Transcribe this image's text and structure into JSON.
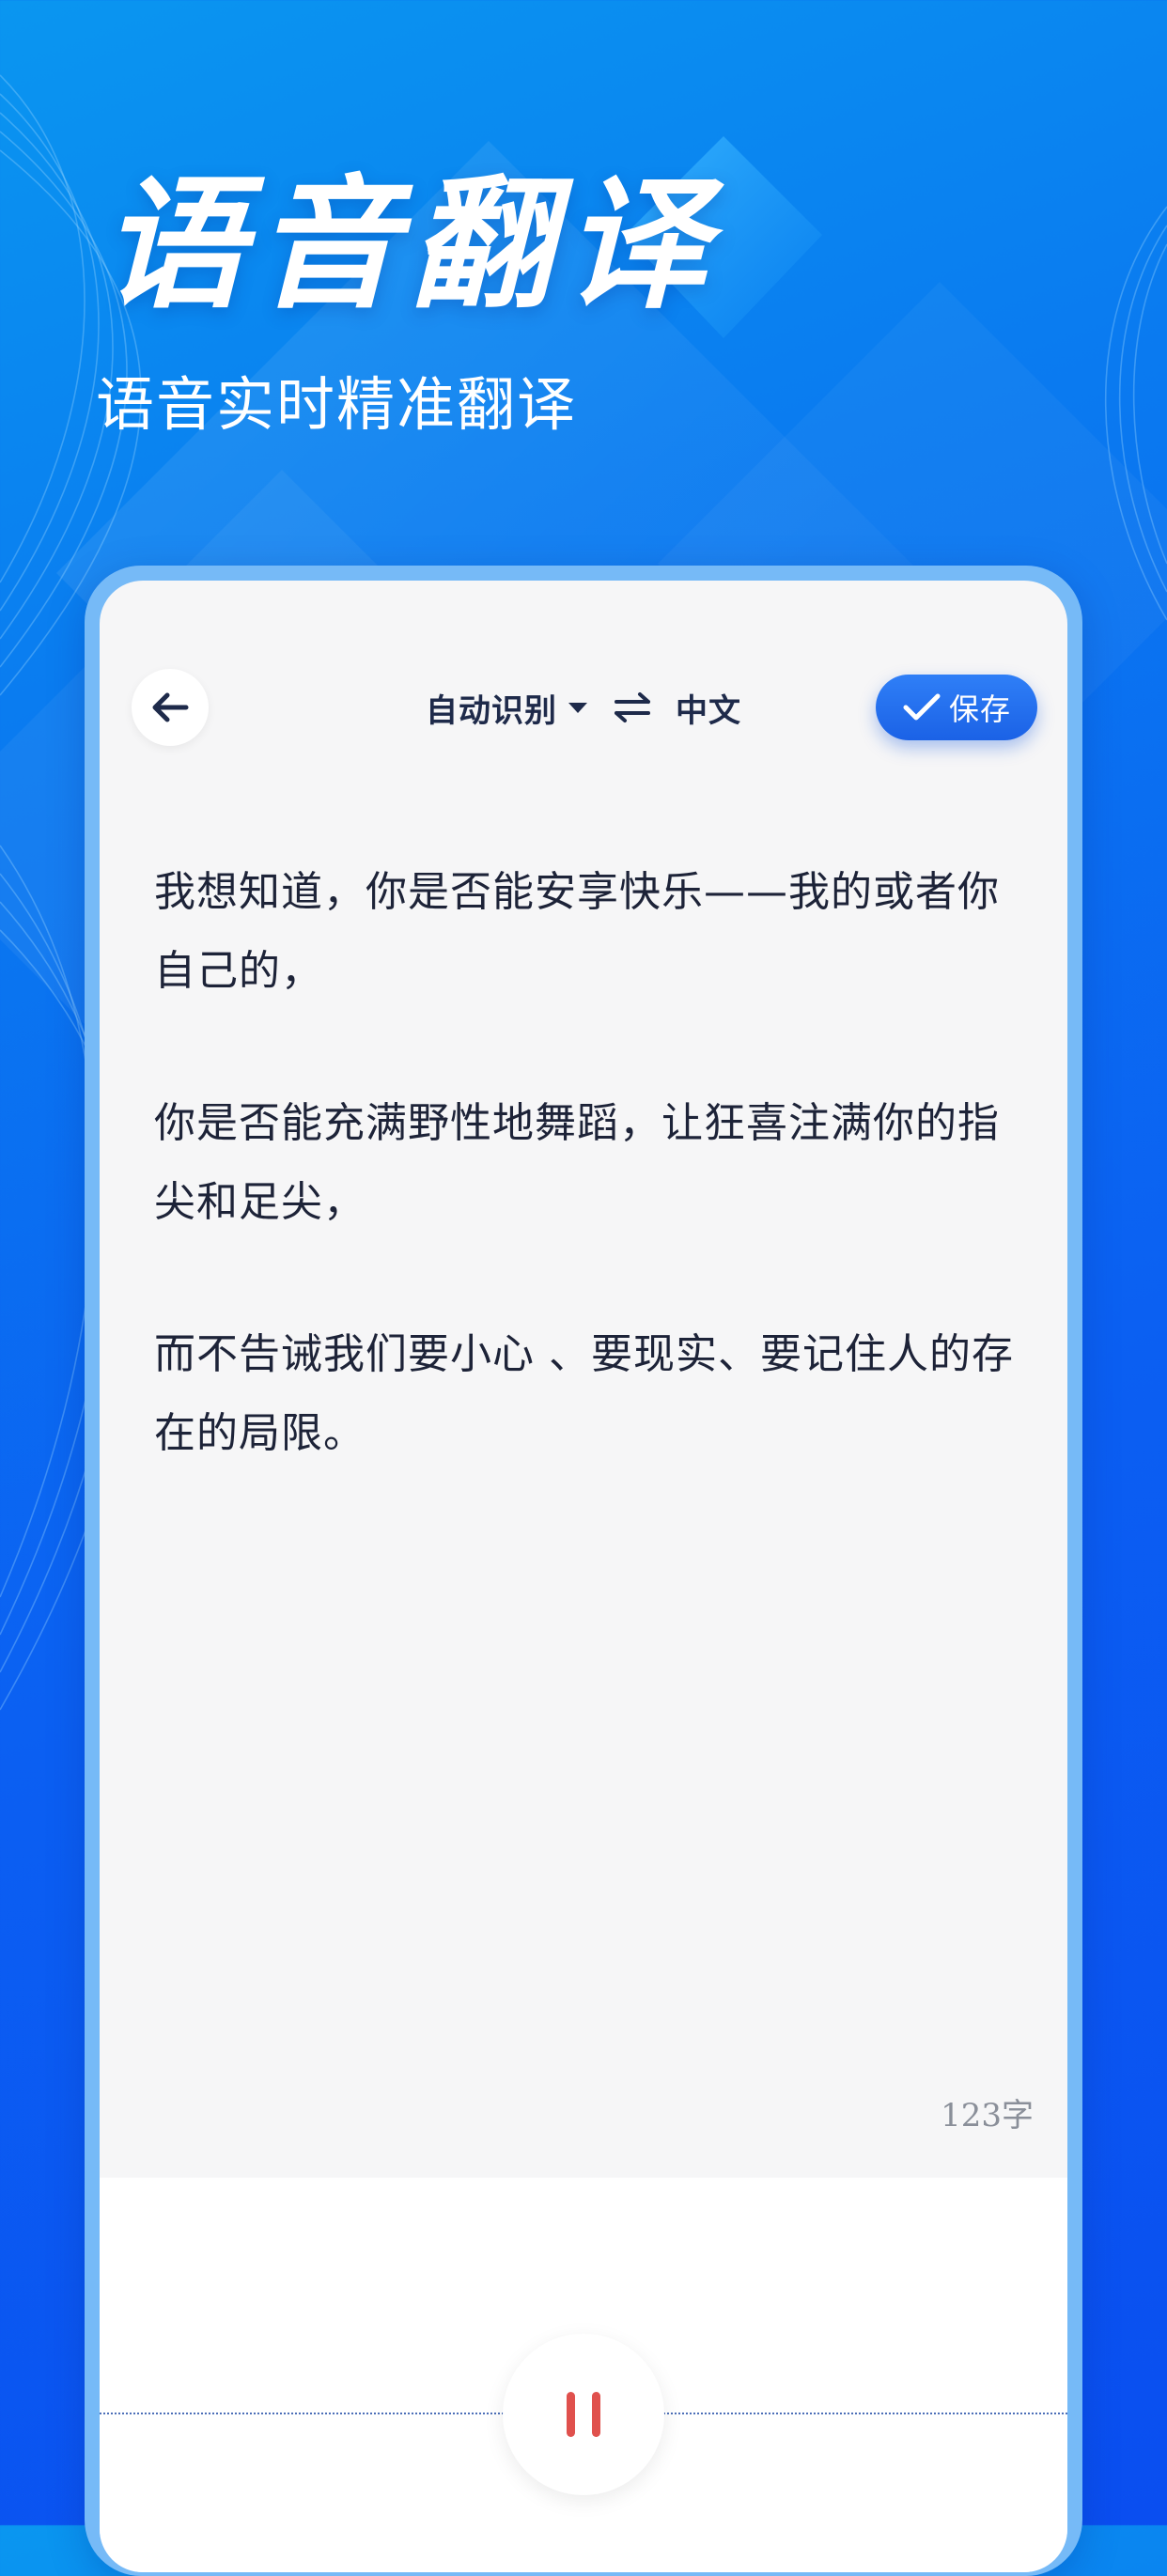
{
  "headline": {
    "title": "语音翻译",
    "subtitle": "语音实时精准翻译"
  },
  "topbar": {
    "back_icon": "arrow-left-icon",
    "source_lang": "自动识别",
    "dropdown_icon": "caret-down-icon",
    "swap_icon": "swap-arrows-icon",
    "target_lang": "中文",
    "save_icon": "check-icon",
    "save_label": "保存"
  },
  "transcript": {
    "paragraphs": [
      "我想知道，你是否能安享快乐——我的或者你自己的，",
      "你是否能充满野性地舞蹈，让狂喜注满你的指尖和足尖，",
      "而不告诫我们要小心 、要现实、要记住人的存在的局限。"
    ],
    "char_count": "123字"
  },
  "recorder": {
    "pause_icon": "pause-icon",
    "state": "recording"
  },
  "colors": {
    "background_top": "#0a96f0",
    "background_bottom": "#0a4ef0",
    "device_frame": "#76baf7",
    "screen_bg": "#f6f6f7",
    "accent": "#1f66ea",
    "text_primary": "#1d2338",
    "pause_red": "#e0514d"
  }
}
